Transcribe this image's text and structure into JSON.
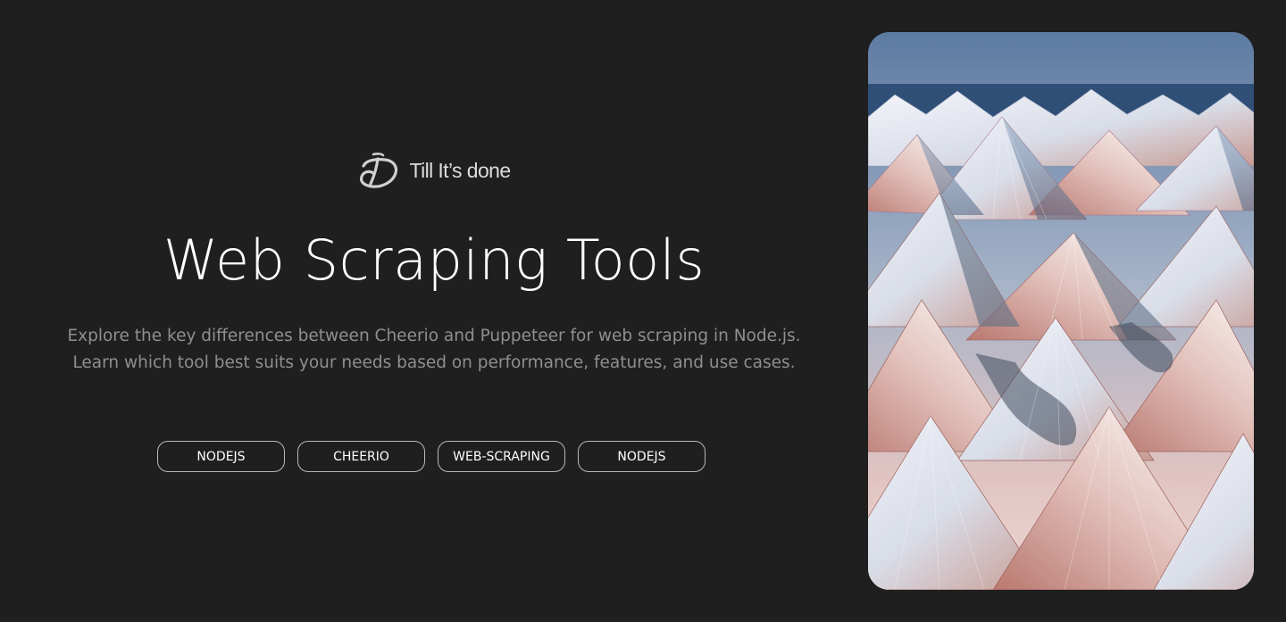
{
  "brand": {
    "name": "Till It’s done",
    "logo_icon": "td-monogram-logo"
  },
  "hero": {
    "title": "Web Scraping Tools",
    "description_line1": "Explore the key differences between Cheerio and Puppeteer for web scraping in Node.js.",
    "description_line2": "Learn which tool best suits your needs based on performance, features, and use cases."
  },
  "tags": [
    "NODEJS",
    "CHEERIO",
    "WEB-SCRAPING",
    "NODEJS"
  ],
  "image": {
    "subject": "snowy-mountain-peaks-artwork"
  },
  "colors": {
    "background": "#1f1f1f",
    "title": "#ffffff",
    "description": "#8f8f8f",
    "tag_border": "#b9b9b9"
  }
}
